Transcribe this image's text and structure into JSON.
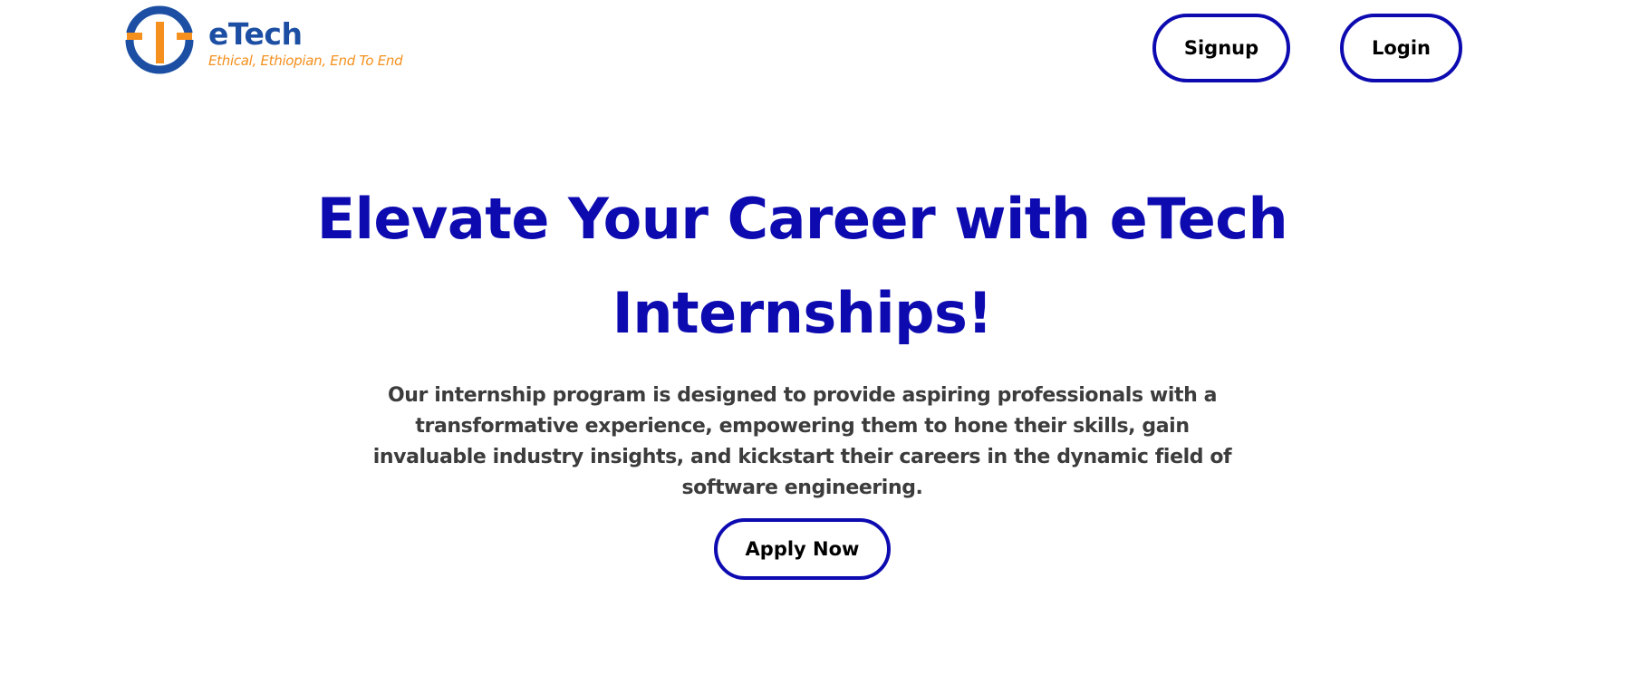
{
  "header": {
    "brand_name": "eTech",
    "brand_tagline": "Ethical, Ethiopian, End To End",
    "logo_icon": "etech-logo-icon",
    "signup_label": "Signup",
    "login_label": "Login"
  },
  "hero": {
    "title": "Elevate Your Career with eTech Internships!",
    "description": "Our internship program is designed to provide aspiring professionals with a transformative experience, empowering them to hone their skills, gain invaluable industry insights, and kickstart their careers in the dynamic field of software engineering.",
    "apply_label": "Apply Now"
  },
  "colors": {
    "primary": "#0d0bb0",
    "logo_blue": "#1c4fa3",
    "logo_orange": "#f5901e",
    "text": "#3c3c3c",
    "background": "#ffffff"
  }
}
